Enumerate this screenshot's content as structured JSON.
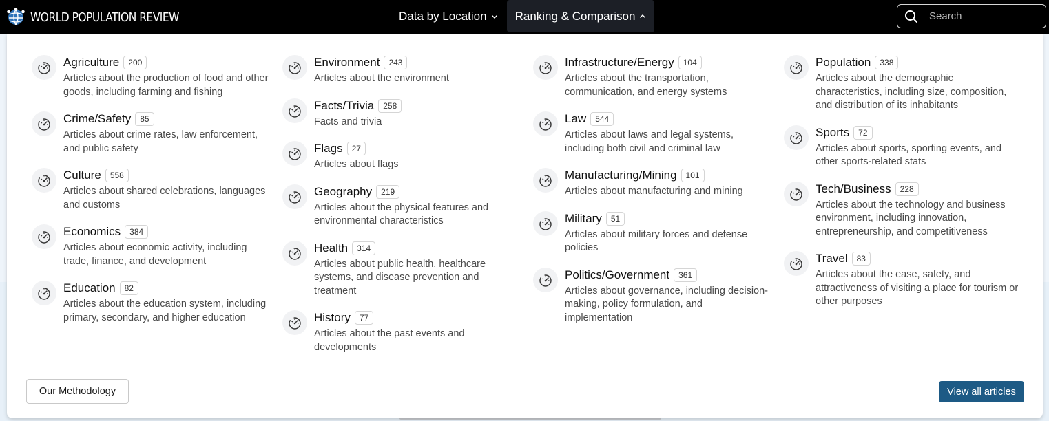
{
  "header": {
    "logo_text": "WORLD POPULATION REVIEW",
    "nav": [
      {
        "label": "Data by Location"
      },
      {
        "label": "Ranking & Comparison"
      }
    ],
    "search_placeholder": "Search"
  },
  "menu": {
    "columns": [
      [
        {
          "title": "Agriculture",
          "count": "200",
          "desc": "Articles about the production of food and other goods, including farming and fishing"
        },
        {
          "title": "Crime/Safety",
          "count": "85",
          "desc": "Articles about crime rates, law enforcement, and public safety"
        },
        {
          "title": "Culture",
          "count": "558",
          "desc": "Articles about shared celebrations, languages and customs"
        },
        {
          "title": "Economics",
          "count": "384",
          "desc": "Articles about economic activity, including trade, finance, and development"
        },
        {
          "title": "Education",
          "count": "82",
          "desc": "Articles about the education system, including primary, secondary, and higher education"
        }
      ],
      [
        {
          "title": "Environment",
          "count": "243",
          "desc": "Articles about the environment"
        },
        {
          "title": "Facts/Trivia",
          "count": "258",
          "desc": "Facts and trivia"
        },
        {
          "title": "Flags",
          "count": "27",
          "desc": "Articles about flags"
        },
        {
          "title": "Geography",
          "count": "219",
          "desc": "Articles about the physical features and environmental characteristics"
        },
        {
          "title": "Health",
          "count": "314",
          "desc": "Articles about public health, healthcare systems, and disease prevention and treatment"
        },
        {
          "title": "History",
          "count": "77",
          "desc": "Articles about the past events and developments"
        }
      ],
      [
        {
          "title": "Infrastructure/Energy",
          "count": "104",
          "desc": "Articles about the transportation, communication, and energy systems"
        },
        {
          "title": "Law",
          "count": "544",
          "desc": "Articles about laws and legal systems, including both civil and criminal law"
        },
        {
          "title": "Manufacturing/Mining",
          "count": "101",
          "desc": "Articles about manufacturing and mining"
        },
        {
          "title": "Military",
          "count": "51",
          "desc": "Articles about military forces and defense policies"
        },
        {
          "title": "Politics/Government",
          "count": "361",
          "desc": "Articles about governance, including decision-making, policy formulation, and implementation"
        }
      ],
      [
        {
          "title": "Population",
          "count": "338",
          "desc": "Articles about the demographic characteristics, including size, composition, and distribution of its inhabitants"
        },
        {
          "title": "Sports",
          "count": "72",
          "desc": "Articles about sports, sporting events, and other sports-related stats"
        },
        {
          "title": "Tech/Business",
          "count": "228",
          "desc": "Articles about the technology and business environment, including innovation, entrepreneurship, and competitiveness"
        },
        {
          "title": "Travel",
          "count": "83",
          "desc": "Articles about the ease, safety, and attractiveness of visiting a place for tourism or other purposes"
        }
      ]
    ],
    "methodology_label": "Our Methodology",
    "view_all_label": "View all articles"
  },
  "colors": {
    "header_bg": "#000000",
    "active_nav_bg": "#1c1f26",
    "primary_button": "#1d5a85"
  },
  "icons": {
    "logo": "globe-people-icon",
    "search": "search-icon",
    "category": "gauge-icon",
    "chevron_down": "chevron-down-icon",
    "chevron_up": "chevron-up-icon"
  }
}
